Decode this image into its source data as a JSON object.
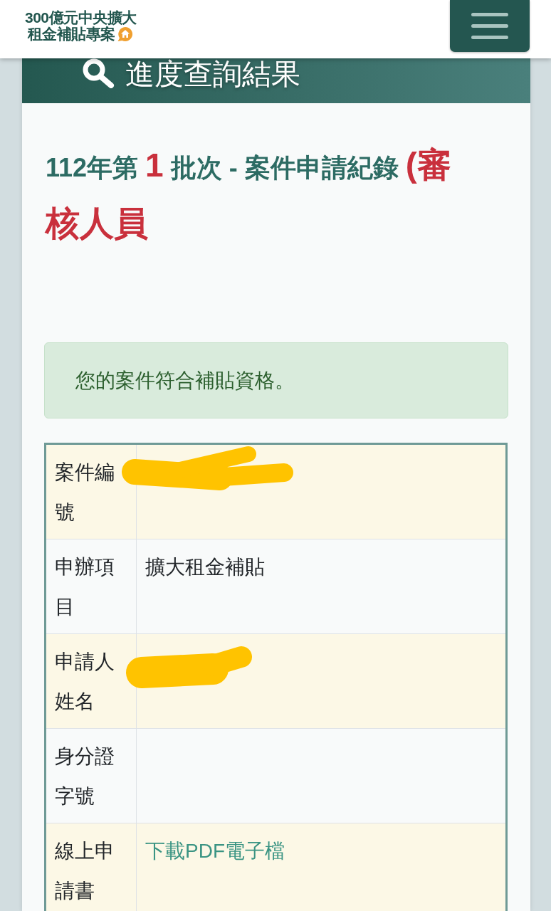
{
  "header": {
    "logo_lines": [
      "300億元中央擴大",
      "租金補貼專案"
    ]
  },
  "results_panel": {
    "title": "進度查詢結果",
    "record_heading": [
      {
        "text": "112年第 ",
        "kind": "plain"
      },
      {
        "text": "1",
        "kind": "number"
      },
      {
        "text": " 批次 - 案件申請紀錄 ",
        "kind": "plain"
      },
      {
        "text": "(審核人員",
        "kind": "note"
      }
    ],
    "alert": {
      "message": "您的案件符合補貼資格。"
    },
    "table": {
      "rows": [
        {
          "label": "案件編號",
          "kind": "scribbled"
        },
        {
          "label": "申辦項目",
          "value": "擴大租金補貼",
          "kind": "text"
        },
        {
          "label": "申請人姓名",
          "kind": "scribbled"
        },
        {
          "label": "身分證字號"
        },
        {
          "label": "線上申請書",
          "value": "下載PDF電子檔",
          "kind": "link"
        }
      ]
    }
  }
}
